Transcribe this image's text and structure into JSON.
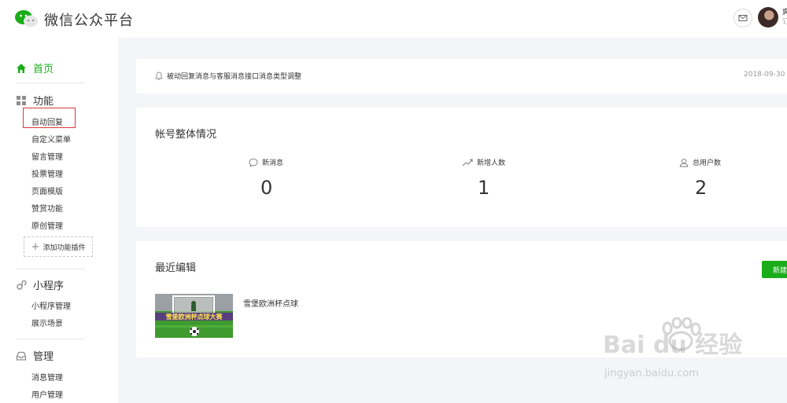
{
  "header": {
    "title": "微信公众平台",
    "user_line1": "爽",
    "user_line2": "订"
  },
  "sidebar": {
    "home": "首页",
    "features": {
      "title": "功能",
      "items": [
        "自动回复",
        "自定义菜单",
        "留言管理",
        "投票管理",
        "页面模版",
        "赞赏功能",
        "原创管理"
      ],
      "add_plugin": "添加功能插件"
    },
    "miniprogram": {
      "title": "小程序",
      "items": [
        "小程序管理",
        "展示场景"
      ]
    },
    "manage": {
      "title": "管理",
      "items": [
        "消息管理",
        "用户管理"
      ]
    }
  },
  "notice": {
    "text": "被动回复消息与客服消息接口消息类型调整",
    "date": "2018-09-30"
  },
  "overview": {
    "title": "帐号整体情况",
    "stats": [
      {
        "label": "新消息",
        "value": "0"
      },
      {
        "label": "新增人数",
        "value": "1"
      },
      {
        "label": "总用户数",
        "value": "2"
      }
    ]
  },
  "recent": {
    "title": "最近编辑",
    "new_button": "新建",
    "item_title": "雪堡欧洲杯点球",
    "thumb_banner": "雪堡欧洲杯点球大赛"
  },
  "watermark": {
    "brand": "Bai du 经验",
    "url": "jingyan.baidu.com"
  },
  "colors": {
    "accent": "#1aad19",
    "highlight_box": "#d9383b",
    "background": "#f4f5f9"
  }
}
